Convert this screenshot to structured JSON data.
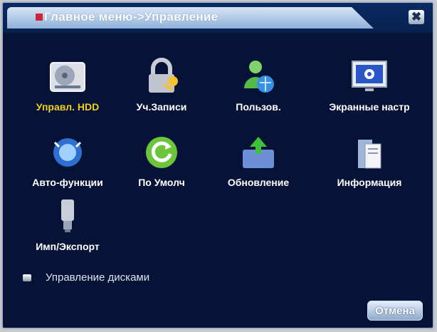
{
  "window": {
    "title": "Главное меню->Управление",
    "close_glyph": "✖"
  },
  "tiles": [
    {
      "label": "Управл. HDD",
      "icon": "hdd-icon",
      "active": true
    },
    {
      "label": "Уч.Записи",
      "icon": "lock-key-icon"
    },
    {
      "label": "Пользов.",
      "icon": "user-globe-icon"
    },
    {
      "label": "Экранные настр",
      "icon": "monitor-gear-icon"
    },
    {
      "label": "Авто-функции",
      "icon": "auto-function-icon"
    },
    {
      "label": "По Умолч",
      "icon": "refresh-icon"
    },
    {
      "label": "Обновление",
      "icon": "upgrade-icon"
    },
    {
      "label": "Информация",
      "icon": "info-icon"
    },
    {
      "label": "Имп/Экспорт",
      "icon": "import-export-icon"
    }
  ],
  "status": {
    "text": "Управление дисками",
    "icon": "disk-status-icon"
  },
  "buttons": {
    "cancel_label": "Отмена"
  },
  "colors": {
    "active_label": "#f0d21a",
    "background": "#061336",
    "text": "#ffffff"
  }
}
